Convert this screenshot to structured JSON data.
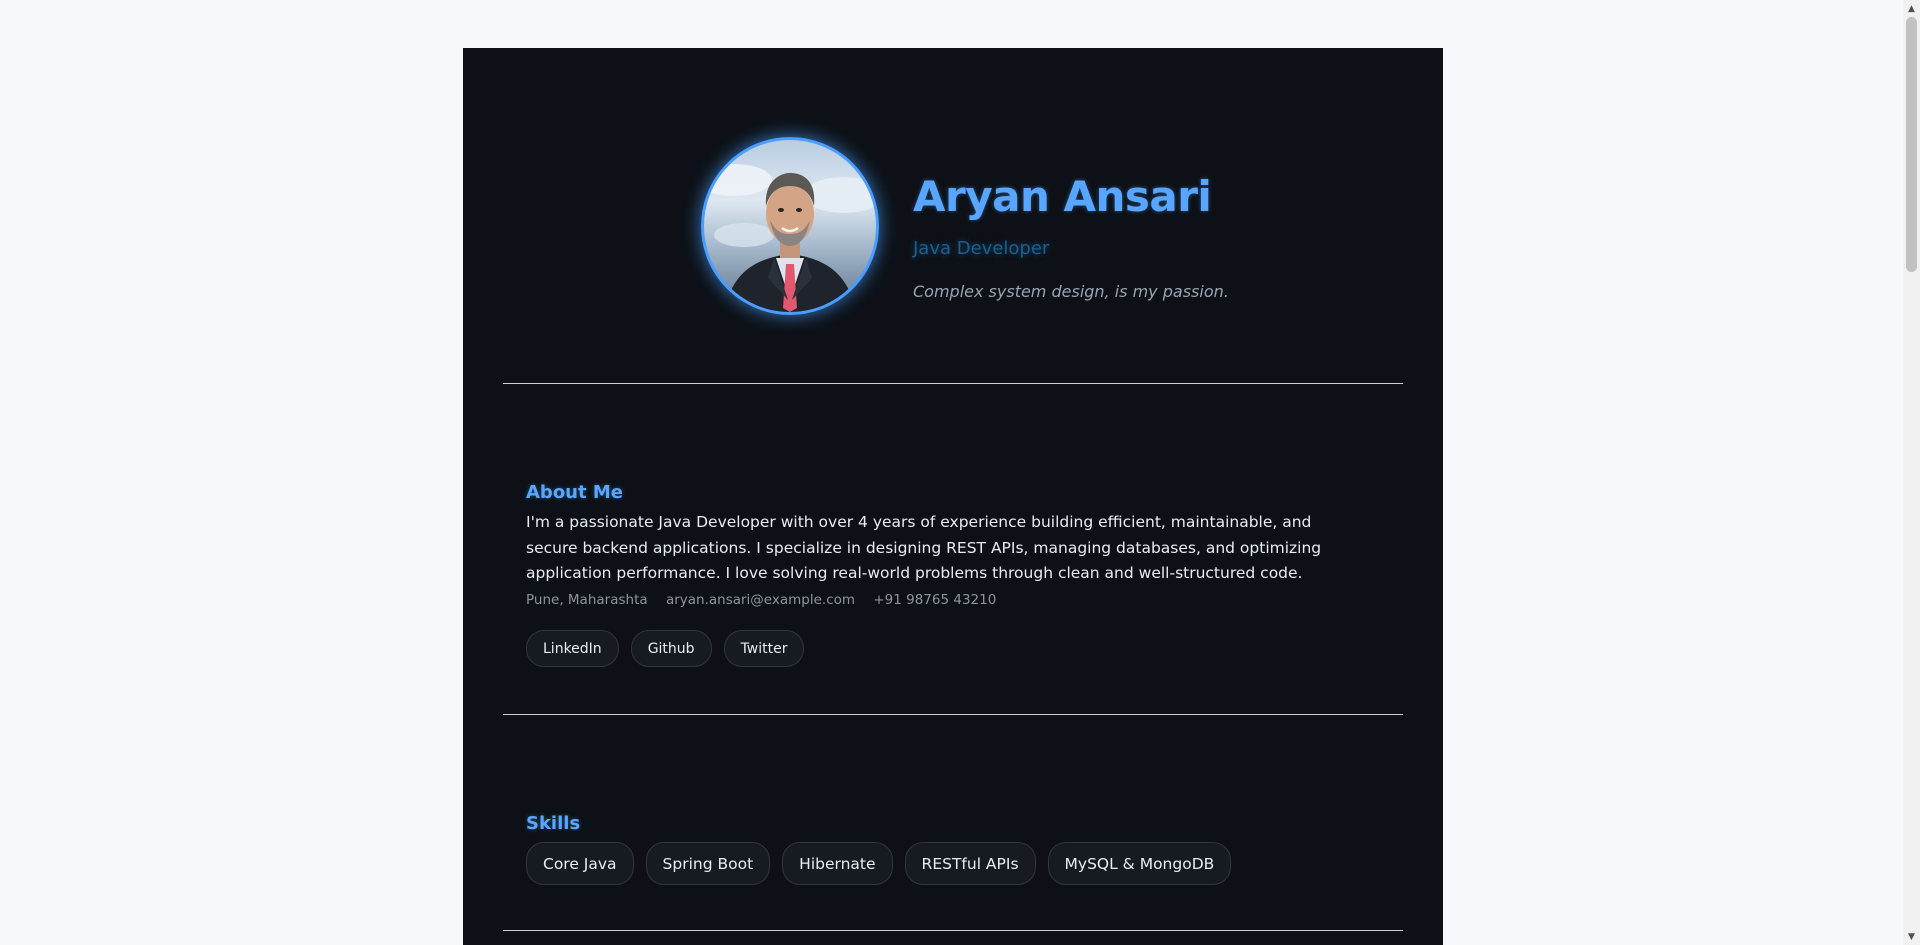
{
  "profile": {
    "name": "Aryan Ansari",
    "role": "Java Developer",
    "tagline": "Complex system design, is my passion."
  },
  "about": {
    "title": "About Me",
    "text": "I'm a passionate Java Developer with over 4 years of experience building efficient, maintainable, and secure backend applications. I specialize in designing REST APIs, managing databases, and optimizing application performance. I love solving real-world problems through clean and well-structured code.",
    "location": "Pune, Maharashta",
    "email": "aryan.ansari@example.com",
    "phone": "+91 98765 43210",
    "links": [
      "LinkedIn",
      "Github",
      "Twitter"
    ]
  },
  "skills": {
    "title": "Skills",
    "items": [
      "Core Java",
      "Spring Boot",
      "Hibernate",
      "RESTful APIs",
      "MySQL & MongoDB"
    ]
  },
  "colors": {
    "page_bg": "#f6f8fb",
    "card_bg": "#0d1117",
    "accent": "#58a6ff",
    "role_text": "#1d5e8c"
  },
  "icons": {
    "scroll_up": "▲",
    "scroll_down": "▼"
  }
}
